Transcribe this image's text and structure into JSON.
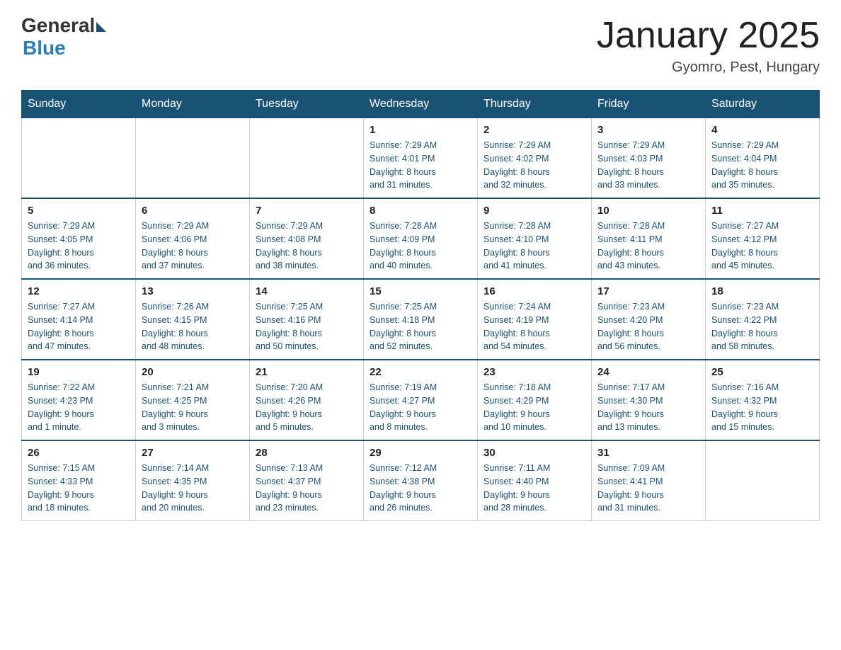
{
  "logo": {
    "general": "General",
    "blue": "Blue"
  },
  "title": "January 2025",
  "location": "Gyomro, Pest, Hungary",
  "days": [
    "Sunday",
    "Monday",
    "Tuesday",
    "Wednesday",
    "Thursday",
    "Friday",
    "Saturday"
  ],
  "weeks": [
    [
      {
        "day": "",
        "info": ""
      },
      {
        "day": "",
        "info": ""
      },
      {
        "day": "",
        "info": ""
      },
      {
        "day": "1",
        "info": "Sunrise: 7:29 AM\nSunset: 4:01 PM\nDaylight: 8 hours\nand 31 minutes."
      },
      {
        "day": "2",
        "info": "Sunrise: 7:29 AM\nSunset: 4:02 PM\nDaylight: 8 hours\nand 32 minutes."
      },
      {
        "day": "3",
        "info": "Sunrise: 7:29 AM\nSunset: 4:03 PM\nDaylight: 8 hours\nand 33 minutes."
      },
      {
        "day": "4",
        "info": "Sunrise: 7:29 AM\nSunset: 4:04 PM\nDaylight: 8 hours\nand 35 minutes."
      }
    ],
    [
      {
        "day": "5",
        "info": "Sunrise: 7:29 AM\nSunset: 4:05 PM\nDaylight: 8 hours\nand 36 minutes."
      },
      {
        "day": "6",
        "info": "Sunrise: 7:29 AM\nSunset: 4:06 PM\nDaylight: 8 hours\nand 37 minutes."
      },
      {
        "day": "7",
        "info": "Sunrise: 7:29 AM\nSunset: 4:08 PM\nDaylight: 8 hours\nand 38 minutes."
      },
      {
        "day": "8",
        "info": "Sunrise: 7:28 AM\nSunset: 4:09 PM\nDaylight: 8 hours\nand 40 minutes."
      },
      {
        "day": "9",
        "info": "Sunrise: 7:28 AM\nSunset: 4:10 PM\nDaylight: 8 hours\nand 41 minutes."
      },
      {
        "day": "10",
        "info": "Sunrise: 7:28 AM\nSunset: 4:11 PM\nDaylight: 8 hours\nand 43 minutes."
      },
      {
        "day": "11",
        "info": "Sunrise: 7:27 AM\nSunset: 4:12 PM\nDaylight: 8 hours\nand 45 minutes."
      }
    ],
    [
      {
        "day": "12",
        "info": "Sunrise: 7:27 AM\nSunset: 4:14 PM\nDaylight: 8 hours\nand 47 minutes."
      },
      {
        "day": "13",
        "info": "Sunrise: 7:26 AM\nSunset: 4:15 PM\nDaylight: 8 hours\nand 48 minutes."
      },
      {
        "day": "14",
        "info": "Sunrise: 7:25 AM\nSunset: 4:16 PM\nDaylight: 8 hours\nand 50 minutes."
      },
      {
        "day": "15",
        "info": "Sunrise: 7:25 AM\nSunset: 4:18 PM\nDaylight: 8 hours\nand 52 minutes."
      },
      {
        "day": "16",
        "info": "Sunrise: 7:24 AM\nSunset: 4:19 PM\nDaylight: 8 hours\nand 54 minutes."
      },
      {
        "day": "17",
        "info": "Sunrise: 7:23 AM\nSunset: 4:20 PM\nDaylight: 8 hours\nand 56 minutes."
      },
      {
        "day": "18",
        "info": "Sunrise: 7:23 AM\nSunset: 4:22 PM\nDaylight: 8 hours\nand 58 minutes."
      }
    ],
    [
      {
        "day": "19",
        "info": "Sunrise: 7:22 AM\nSunset: 4:23 PM\nDaylight: 9 hours\nand 1 minute."
      },
      {
        "day": "20",
        "info": "Sunrise: 7:21 AM\nSunset: 4:25 PM\nDaylight: 9 hours\nand 3 minutes."
      },
      {
        "day": "21",
        "info": "Sunrise: 7:20 AM\nSunset: 4:26 PM\nDaylight: 9 hours\nand 5 minutes."
      },
      {
        "day": "22",
        "info": "Sunrise: 7:19 AM\nSunset: 4:27 PM\nDaylight: 9 hours\nand 8 minutes."
      },
      {
        "day": "23",
        "info": "Sunrise: 7:18 AM\nSunset: 4:29 PM\nDaylight: 9 hours\nand 10 minutes."
      },
      {
        "day": "24",
        "info": "Sunrise: 7:17 AM\nSunset: 4:30 PM\nDaylight: 9 hours\nand 13 minutes."
      },
      {
        "day": "25",
        "info": "Sunrise: 7:16 AM\nSunset: 4:32 PM\nDaylight: 9 hours\nand 15 minutes."
      }
    ],
    [
      {
        "day": "26",
        "info": "Sunrise: 7:15 AM\nSunset: 4:33 PM\nDaylight: 9 hours\nand 18 minutes."
      },
      {
        "day": "27",
        "info": "Sunrise: 7:14 AM\nSunset: 4:35 PM\nDaylight: 9 hours\nand 20 minutes."
      },
      {
        "day": "28",
        "info": "Sunrise: 7:13 AM\nSunset: 4:37 PM\nDaylight: 9 hours\nand 23 minutes."
      },
      {
        "day": "29",
        "info": "Sunrise: 7:12 AM\nSunset: 4:38 PM\nDaylight: 9 hours\nand 26 minutes."
      },
      {
        "day": "30",
        "info": "Sunrise: 7:11 AM\nSunset: 4:40 PM\nDaylight: 9 hours\nand 28 minutes."
      },
      {
        "day": "31",
        "info": "Sunrise: 7:09 AM\nSunset: 4:41 PM\nDaylight: 9 hours\nand 31 minutes."
      },
      {
        "day": "",
        "info": ""
      }
    ]
  ]
}
